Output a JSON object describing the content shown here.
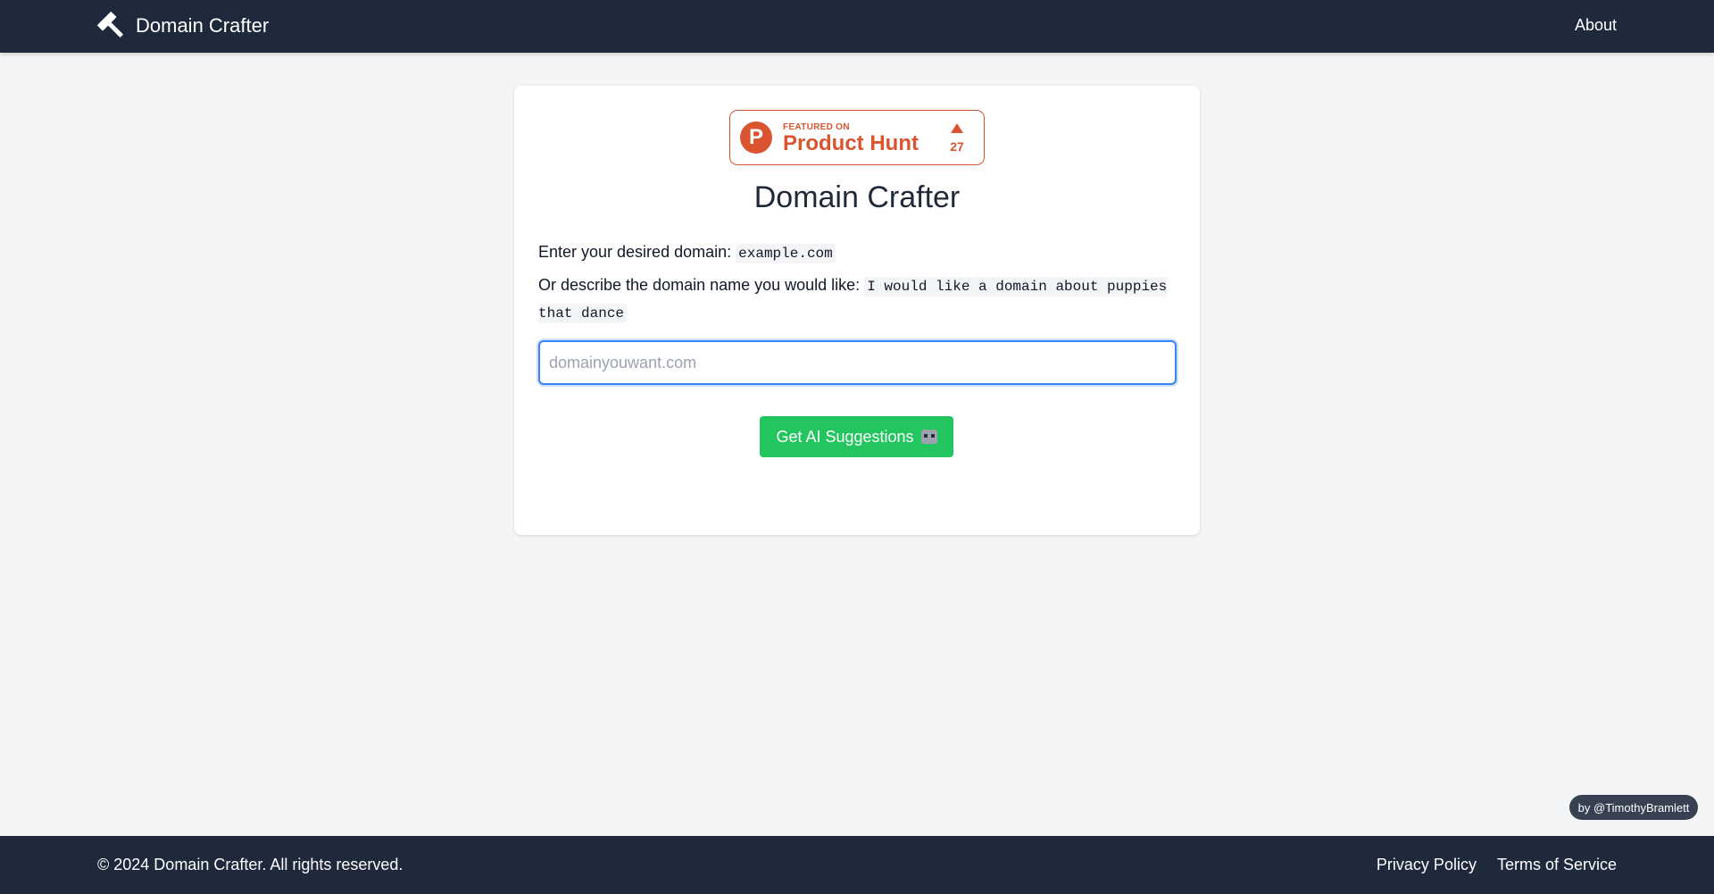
{
  "header": {
    "brand": "Domain Crafter",
    "brand_icon": "hammer-icon",
    "nav_about": "About",
    "background_color": "#1e293b"
  },
  "product_hunt": {
    "featured_label": "FEATURED ON",
    "name": "Product Hunt",
    "logo_letter": "P",
    "upvote_icon": "triangle-up-icon",
    "upvotes": "27",
    "accent_color": "#da552f"
  },
  "main": {
    "title": "Domain Crafter",
    "instruction_1": "Enter your desired domain:",
    "example_1": "example.com",
    "instruction_2": "Or describe the domain name you would like:",
    "example_2": "I would like a domain about puppies that dance",
    "input": {
      "value": "",
      "placeholder": "domainyouwant.com"
    },
    "button_label": "Get AI Suggestions",
    "button_icon": "robot-icon",
    "button_color": "#22c55e"
  },
  "credit": "by @TimothyBramlett",
  "footer": {
    "copyright": "© 2024 Domain Crafter. All rights reserved.",
    "links": [
      "Privacy Policy",
      "Terms of Service"
    ]
  }
}
